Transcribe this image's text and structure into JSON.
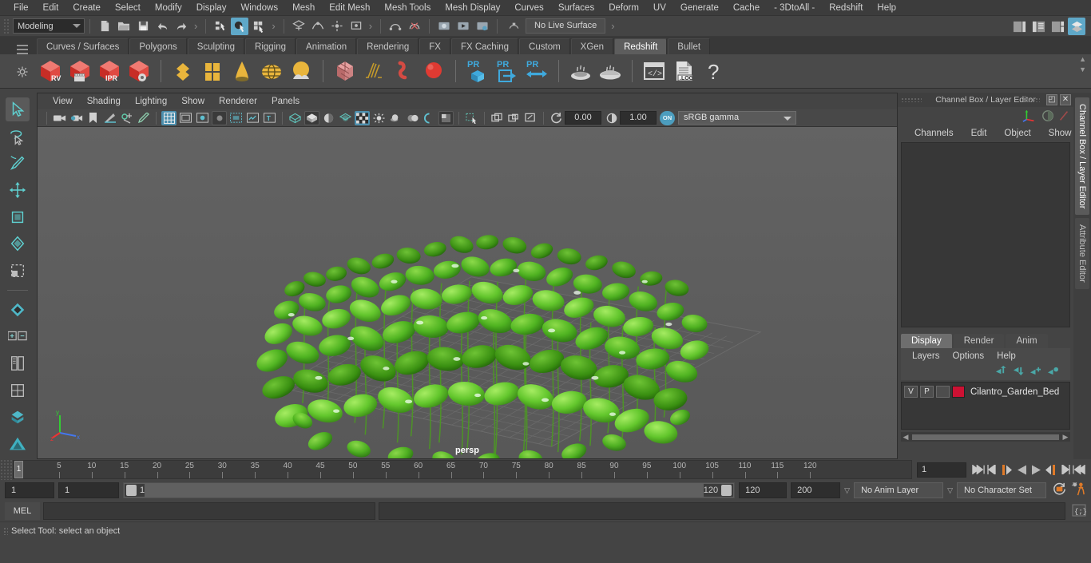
{
  "menubar": {
    "items": [
      "File",
      "Edit",
      "Create",
      "Select",
      "Modify",
      "Display",
      "Windows",
      "Mesh",
      "Edit Mesh",
      "Mesh Tools",
      "Mesh Display",
      "Curves",
      "Surfaces",
      "Deform",
      "UV",
      "Generate",
      "Cache",
      "- 3DtoAll -",
      "Redshift",
      "Help"
    ]
  },
  "statusbar": {
    "menuset": "Modeling",
    "live_surface": "No Live Surface",
    "icons": [
      "new-scene-icon",
      "open-scene-icon",
      "save-scene-icon",
      "undo-icon",
      "redo-icon",
      "select-hierarchy-icon",
      "select-object-icon",
      "select-component-icon",
      "snap-grid-icon",
      "snap-curve-icon",
      "snap-point-icon",
      "snap-view-plane-icon",
      "construction-history-icon",
      "render-icon",
      "render-sequence-icon",
      "ipr-render-icon",
      "render-settings-icon",
      "open-editor-icon",
      "sidebar-attribute-icon",
      "sidebar-tool-icon",
      "sidebar-channel-icon",
      "sidebar-layer-icon"
    ]
  },
  "shelf": {
    "tabs": [
      "Curves / Surfaces",
      "Polygons",
      "Sculpting",
      "Rigging",
      "Animation",
      "Rendering",
      "FX",
      "FX Caching",
      "Custom",
      "XGen",
      "Redshift",
      "Bullet"
    ],
    "active_tab": "Redshift",
    "buttons": [
      {
        "name": "redshift-rv-icon",
        "label": "RV"
      },
      {
        "name": "redshift-render-sequence-icon",
        "label": ""
      },
      {
        "name": "redshift-ipr-icon",
        "label": "IPR"
      },
      {
        "name": "redshift-settings-icon",
        "label": ""
      },
      {
        "name": "redshift-proxy-icon",
        "label": ""
      },
      {
        "name": "redshift-matte-icon",
        "label": ""
      },
      {
        "name": "redshift-light-cone-icon",
        "label": ""
      },
      {
        "name": "redshift-dome-light-icon",
        "label": ""
      },
      {
        "name": "redshift-environment-icon",
        "label": ""
      },
      {
        "name": "redshift-volume-icon",
        "label": ""
      },
      {
        "name": "redshift-hair-icon",
        "label": ""
      },
      {
        "name": "redshift-curve-icon",
        "label": ""
      },
      {
        "name": "redshift-sphere-icon",
        "label": ""
      },
      {
        "name": "redshift-pr-proxy-icon",
        "label": "PR"
      },
      {
        "name": "redshift-pr-export-icon",
        "label": "PR"
      },
      {
        "name": "redshift-pr-exchange-icon",
        "label": "PR"
      },
      {
        "name": "redshift-bake-icon",
        "label": ""
      },
      {
        "name": "redshift-bake-set-icon",
        "label": ""
      },
      {
        "name": "redshift-script-icon",
        "label": ""
      },
      {
        "name": "redshift-log-icon",
        "label": ".LOG"
      },
      {
        "name": "redshift-help-icon",
        "label": "?"
      }
    ]
  },
  "toolbox": {
    "tools": [
      "select-tool",
      "lasso-select-tool",
      "paint-select-tool",
      "move-tool",
      "rotate-tool",
      "scale-tool",
      "soft-select-tool",
      "show-manipulator-tool",
      "last-tool",
      "xyz-tool",
      "snap-tool"
    ]
  },
  "viewport": {
    "menus": [
      "View",
      "Shading",
      "Lighting",
      "Show",
      "Renderer",
      "Panels"
    ],
    "exposure": "0.00",
    "gamma": "1.00",
    "color_space": "sRGB gamma",
    "color_mgmt_toggle": "ON",
    "camera_label": "persp",
    "axis": {
      "x": "x",
      "y": "y",
      "z": "z"
    }
  },
  "channelbox": {
    "title": "Channel Box / Layer Editor",
    "menus": [
      "Channels",
      "Edit",
      "Object",
      "Show"
    ],
    "window_buttons": [
      "restore-window-icon",
      "close-window-icon"
    ]
  },
  "layer_editor": {
    "tabs": [
      "Display",
      "Render",
      "Anim"
    ],
    "active_tab": "Display",
    "menus": [
      "Layers",
      "Options",
      "Help"
    ],
    "toolbar_icons": [
      "move-layer-up-icon",
      "move-layer-down-icon",
      "create-layer-icon",
      "create-layer-from-selected-icon"
    ],
    "layers": [
      {
        "visibility": "V",
        "playback": "P",
        "shading": "",
        "color": "#cc1133",
        "name": "Cilantro_Garden_Bed"
      }
    ]
  },
  "vertical_tabs": [
    "Channel Box / Layer Editor",
    "Attribute Editor"
  ],
  "timeline": {
    "ticks": [
      5,
      10,
      15,
      20,
      25,
      30,
      35,
      40,
      45,
      50,
      55,
      60,
      65,
      70,
      75,
      80,
      85,
      90,
      95,
      100,
      105,
      110,
      115,
      120
    ],
    "current_frame": "1",
    "current_frame_field": "1",
    "playback_buttons": [
      "go-to-start-icon",
      "step-back-keyframe-icon",
      "step-back-frame-icon",
      "play-backwards-icon",
      "play-forwards-icon",
      "step-forward-frame-icon",
      "step-forward-keyframe-icon",
      "go-to-end-icon"
    ]
  },
  "range": {
    "start_time": "1",
    "range_start": "1",
    "slider_start_label": "1",
    "slider_end_label": "120",
    "range_end": "120",
    "end_time": "200",
    "anim_layer": "No Anim Layer",
    "character_set": "No Character Set",
    "icons": [
      "auto-keyframe-icon",
      "animation-preferences-icon"
    ]
  },
  "command_line": {
    "language": "MEL",
    "input_value": "",
    "script-editor-icon": "script-editor-icon"
  },
  "statusline": {
    "message": "Select Tool: select an object"
  },
  "colors": {
    "accent_blue": "#4c8fae",
    "shelf_redshift_red": "#d33a33",
    "shelf_yellow": "#e8b43c",
    "layer_red": "#cc1133",
    "bg_dark": "#444444"
  }
}
